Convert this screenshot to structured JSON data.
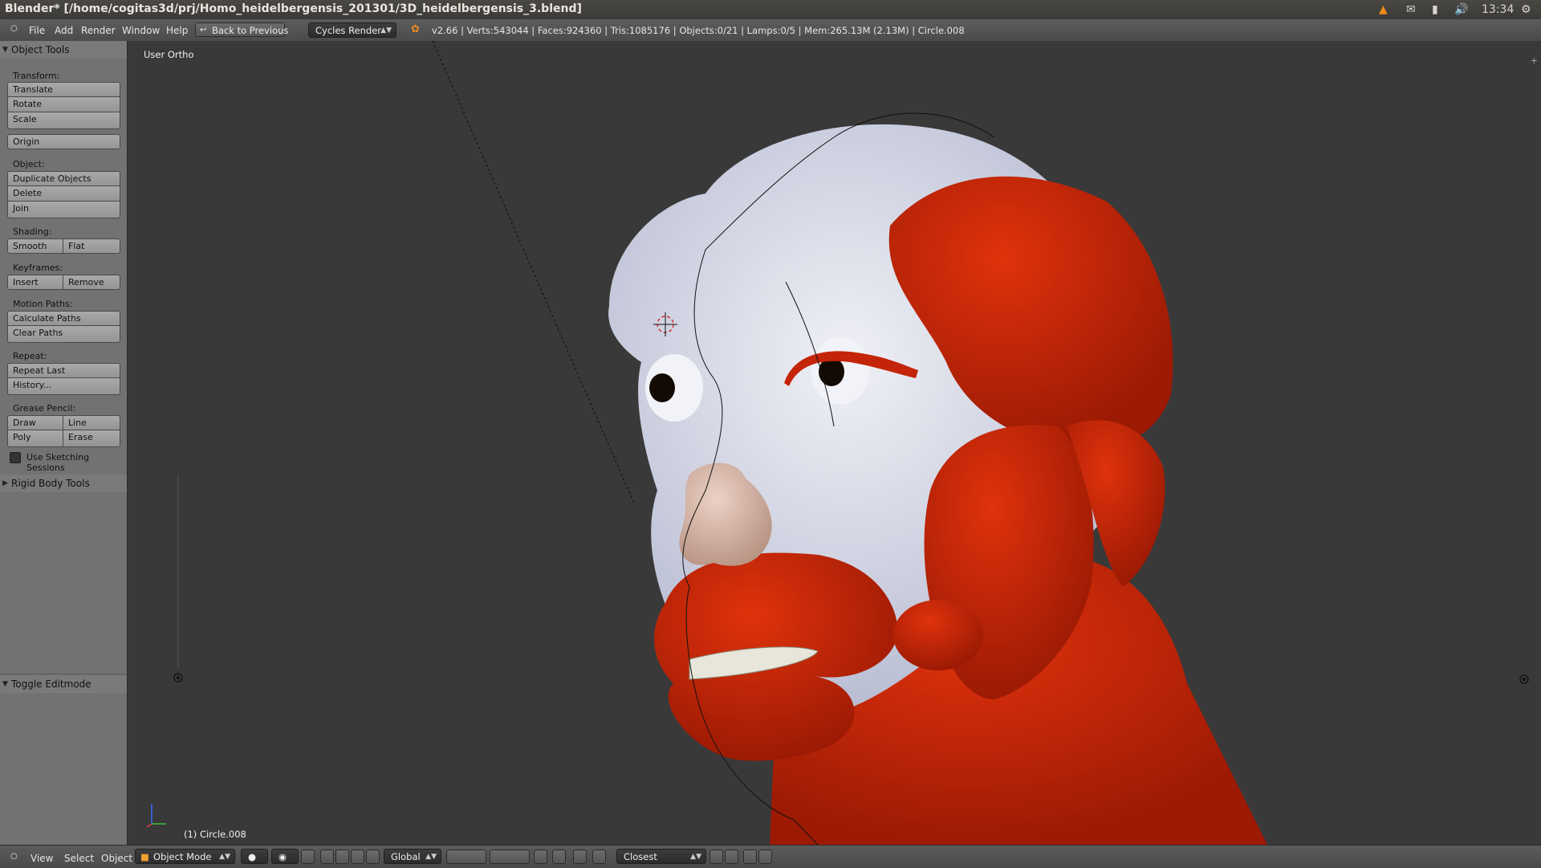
{
  "os_bar": {
    "title": "Blender* [/home/cogitas3d/prj/Homo_heidelbergensis_201301/3D_heidelbergensis_3.blend]",
    "clock": "13:34"
  },
  "header": {
    "menus": [
      "File",
      "Add",
      "Render",
      "Window",
      "Help"
    ],
    "back_button": "Back to Previous",
    "render_engine": "Cycles Render",
    "stats": "v2.66 | Verts:543044 | Faces:924360 | Tris:1085176 | Objects:0/21 | Lamps:0/5 | Mem:265.13M (2.13M) | Circle.008"
  },
  "toolshelf": {
    "object_tools_title": "Object Tools",
    "transform_label": "Transform:",
    "translate": "Translate",
    "rotate": "Rotate",
    "scale": "Scale",
    "origin": "Origin",
    "object_label": "Object:",
    "duplicate": "Duplicate Objects",
    "delete": "Delete",
    "join": "Join",
    "shading_label": "Shading:",
    "smooth": "Smooth",
    "flat": "Flat",
    "keyframes_label": "Keyframes:",
    "insert": "Insert",
    "remove": "Remove",
    "motion_label": "Motion Paths:",
    "calc_paths": "Calculate Paths",
    "clear_paths": "Clear Paths",
    "repeat_label": "Repeat:",
    "repeat_last": "Repeat Last",
    "history": "History...",
    "grease_label": "Grease Pencil:",
    "draw": "Draw",
    "line": "Line",
    "poly": "Poly",
    "erase": "Erase",
    "sketch": "Use Sketching Sessions",
    "rigid_body": "Rigid Body Tools",
    "toggle_edit": "Toggle Editmode"
  },
  "viewport": {
    "view_name": "User Ortho",
    "active_object": "(1) Circle.008"
  },
  "bottom_bar": {
    "menus": [
      "View",
      "Select",
      "Object"
    ],
    "mode": "Object Mode",
    "orientation": "Global",
    "snap": "Closest"
  },
  "colors": {
    "muscle_red": "#c42408",
    "skull_white": "#d8dbe8",
    "nose_skin": "#d9b8a8"
  }
}
